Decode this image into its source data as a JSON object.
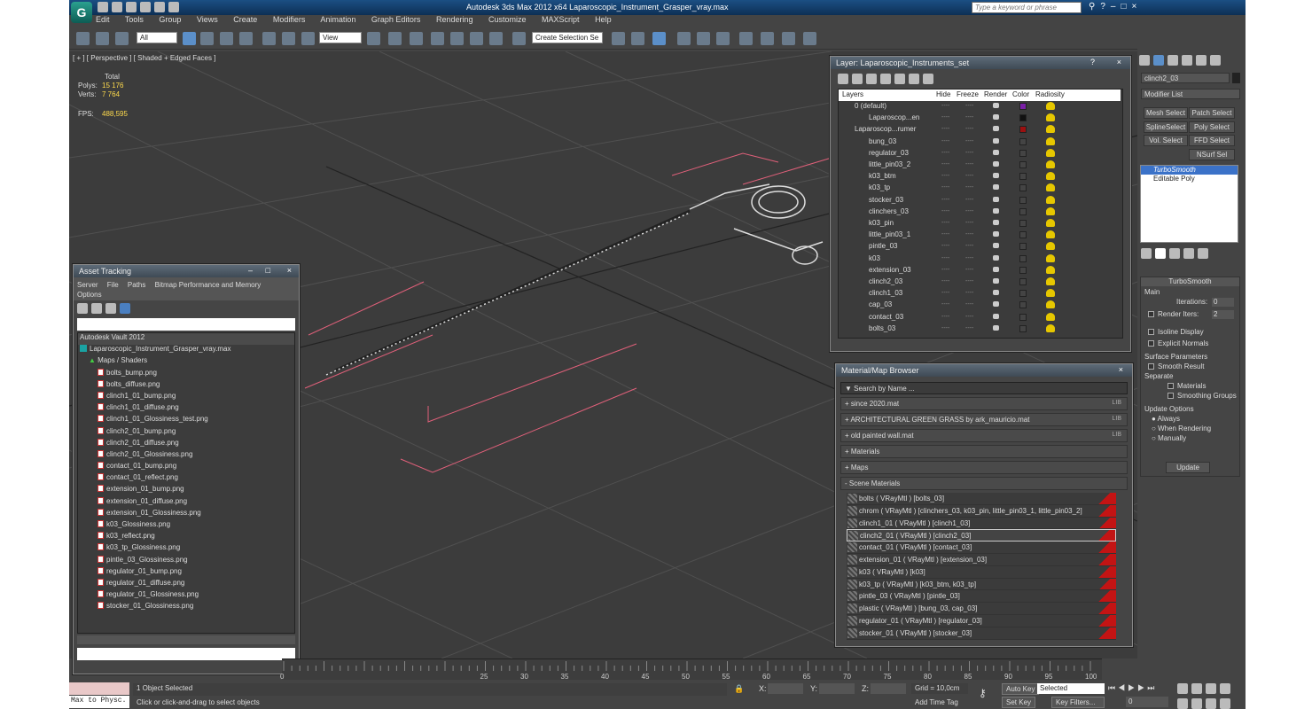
{
  "app": {
    "title": "Autodesk 3ds Max  2012 x64     Laparoscopic_Instrument_Grasper_vray.max",
    "search_placeholder": "Type a keyword or phrase",
    "logo_letter": "G"
  },
  "menu": [
    "Edit",
    "Tools",
    "Group",
    "Views",
    "Create",
    "Modifiers",
    "Animation",
    "Graph Editors",
    "Rendering",
    "Customize",
    "MAXScript",
    "Help"
  ],
  "toolbar": {
    "selection_filter": "All",
    "reference_coord": "View",
    "named_selection": "Create Selection Se"
  },
  "viewport": {
    "label": "[ + ] [ Perspective ] [ Shaded + Edged Faces ]",
    "stats": {
      "total_label": "Total",
      "polys_label": "Polys:",
      "polys_value": "15 176",
      "verts_label": "Verts:",
      "verts_value": "7 764",
      "fps_label": "FPS:",
      "fps_value": "488,595"
    }
  },
  "asset_tracking": {
    "title": "Asset Tracking",
    "menu": [
      "Server",
      "File",
      "Paths",
      "Bitmap Performance and Memory"
    ],
    "menu2": "Options",
    "vault": "Autodesk Vault 2012",
    "scene_file": "Laparoscopic_Instrument_Grasper_vray.max",
    "group": "Maps / Shaders",
    "files": [
      "bolts_bump.png",
      "bolts_diffuse.png",
      "clinch1_01_bump.png",
      "clinch1_01_diffuse.png",
      "clinch1_01_Glossiness_test.png",
      "clinch2_01_bump.png",
      "clinch2_01_diffuse.png",
      "clinch2_01_Glossiness.png",
      "contact_01_bump.png",
      "contact_01_reflect.png",
      "extension_01_bump.png",
      "extension_01_diffuse.png",
      "extension_01_Glossiness.png",
      "k03_Glossiness.png",
      "k03_reflect.png",
      "k03_tp_Glossiness.png",
      "pintle_03_Glossiness.png",
      "regulator_01_bump.png",
      "regulator_01_diffuse.png",
      "regulator_01_Glossiness.png",
      "stocker_01_Glossiness.png"
    ]
  },
  "layers": {
    "title": "Layer: Laparoscopic_Instruments_set",
    "col_layers": "Layers",
    "col_hide": "Hide",
    "col_freeze": "Freeze",
    "col_render": "Render",
    "col_color": "Color",
    "col_radiosity": "Radiosity",
    "dots": "----",
    "rows": [
      {
        "name": "0 (default)",
        "indent": 0,
        "color": "#7a1fa6"
      },
      {
        "name": "Laparoscop...en",
        "indent": 1,
        "color": "#111111"
      },
      {
        "name": "Laparoscop...rumer",
        "indent": 0,
        "color": "#9c1010"
      },
      {
        "name": "bung_03",
        "indent": 1,
        "color": "#444444"
      },
      {
        "name": "regulator_03",
        "indent": 1,
        "color": "#444444"
      },
      {
        "name": "little_pin03_2",
        "indent": 1,
        "color": "#444444"
      },
      {
        "name": "k03_btm",
        "indent": 1,
        "color": "#444444"
      },
      {
        "name": "k03_tp",
        "indent": 1,
        "color": "#444444"
      },
      {
        "name": "stocker_03",
        "indent": 1,
        "color": "#444444"
      },
      {
        "name": "clinchers_03",
        "indent": 1,
        "color": "#444444"
      },
      {
        "name": "k03_pin",
        "indent": 1,
        "color": "#444444"
      },
      {
        "name": "little_pin03_1",
        "indent": 1,
        "color": "#444444"
      },
      {
        "name": "pintle_03",
        "indent": 1,
        "color": "#444444"
      },
      {
        "name": "k03",
        "indent": 1,
        "color": "#444444"
      },
      {
        "name": "extension_03",
        "indent": 1,
        "color": "#444444"
      },
      {
        "name": "clinch2_03",
        "indent": 1,
        "color": "#444444"
      },
      {
        "name": "clinch1_03",
        "indent": 1,
        "color": "#444444"
      },
      {
        "name": "cap_03",
        "indent": 1,
        "color": "#444444"
      },
      {
        "name": "contact_03",
        "indent": 1,
        "color": "#444444"
      },
      {
        "name": "bolts_03",
        "indent": 1,
        "color": "#444444"
      }
    ]
  },
  "material_browser": {
    "title": "Material/Map Browser",
    "search_placeholder": "Search by Name ...",
    "lib_tag": "LIB",
    "libraries": [
      {
        "label": "+ since 2020.mat",
        "lib": true
      },
      {
        "label": "+ ARCHITECTURAL GREEN GRASS by ark_mauricio.mat",
        "lib": true
      },
      {
        "label": "+ old painted wall.mat",
        "lib": true
      },
      {
        "label": "+ Materials",
        "lib": false
      },
      {
        "label": "+ Maps",
        "lib": false
      },
      {
        "label": "- Scene Materials",
        "lib": false
      }
    ],
    "scene_materials": [
      "bolts  ( VRayMtl ) [bolts_03]",
      "chrom  ( VRayMtl ) [clinchers_03, k03_pin, little_pin03_1, little_pin03_2]",
      "clinch1_01  ( VRayMtl ) [clinch1_03]",
      "clinch2_01  ( VRayMtl ) [clinch2_03]",
      "contact_01  ( VRayMtl ) [contact_03]",
      "extension_01  ( VRayMtl ) [extension_03]",
      "k03  ( VRayMtl ) [k03]",
      "k03_tp  ( VRayMtl ) [k03_btm, k03_tp]",
      "pintle_03  ( VRayMtl ) [pintle_03]",
      "plastic  ( VRayMtl ) [bung_03, cap_03]",
      "regulator_01  ( VRayMtl ) [regulator_03]",
      "stocker_01  ( VRayMtl ) [stocker_03]"
    ]
  },
  "command_panel": {
    "object_name": "clinch2_03",
    "modifier_list": "Modifier List",
    "buttons": [
      "Mesh Select",
      "Patch Select",
      "SplineSelect",
      "Poly Select",
      "Vol. Select",
      "FFD Select",
      "NSurf Sel"
    ],
    "stack": [
      "TurboSmooth",
      "Editable Poly"
    ],
    "rollout_title": "TurboSmooth",
    "main_label": "Main",
    "iterations_label": "Iterations:",
    "iterations_value": "0",
    "render_iters_label": "Render Iters:",
    "render_iters_value": "2",
    "isoline": "Isoline Display",
    "explicit_normals": "Explicit Normals",
    "surface_params": "Surface Parameters",
    "smooth_result": "Smooth Result",
    "separate": "Separate",
    "materials": "Materials",
    "smoothing_groups": "Smoothing Groups",
    "update_options": "Update Options",
    "always": "Always",
    "when_rendering": "When Rendering",
    "manually": "Manually",
    "update_button": "Update"
  },
  "timeline": {
    "ticks": [
      "0",
      "25",
      "30",
      "35",
      "40",
      "45",
      "50",
      "55",
      "60",
      "65",
      "70",
      "75",
      "80",
      "85",
      "90",
      "95",
      "100"
    ]
  },
  "status": {
    "maxscript": "Max to Physc.",
    "selected": "1 Object Selected",
    "prompt": "Click or click-and-drag to select objects",
    "x_label": "X:",
    "y_label": "Y:",
    "z_label": "Z:",
    "grid": "Grid = 10,0cm",
    "add_time_tag": "Add Time Tag",
    "auto_key": "Auto Key",
    "set_key": "Set Key",
    "selected_combo": "Selected",
    "key_filters": "Key Filters...",
    "frame": "0"
  }
}
